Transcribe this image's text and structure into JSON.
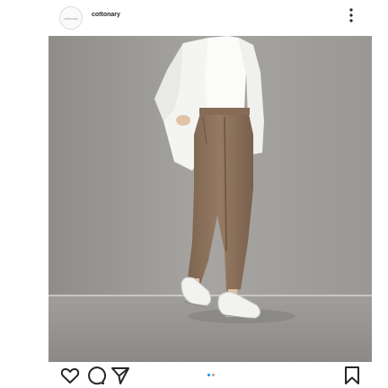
{
  "post": {
    "avatar_text": "cottonary",
    "username": "cottonary",
    "carousel": {
      "count": 2,
      "active_index": 0
    }
  },
  "colors": {
    "accent": "#0095f6",
    "icon": "#262626",
    "dot_inactive": "#a8a8a8"
  },
  "icons": {
    "more": "more-vertical-icon",
    "like": "heart-icon",
    "comment": "comment-icon",
    "share": "share-icon",
    "save": "bookmark-icon"
  }
}
